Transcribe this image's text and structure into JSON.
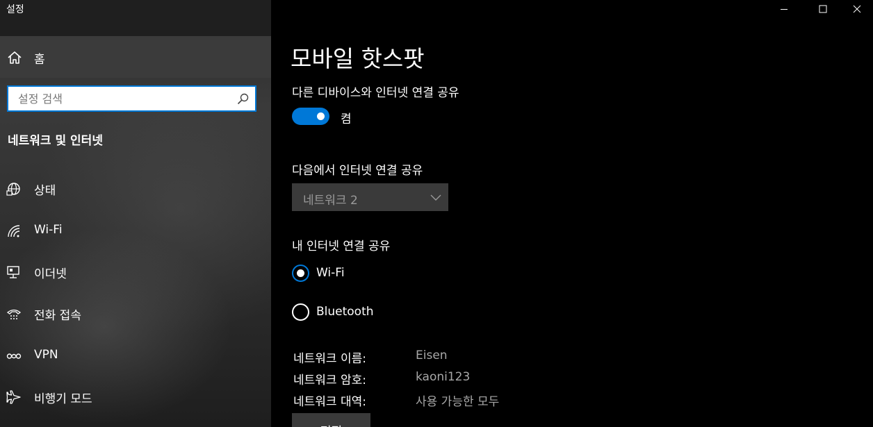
{
  "window": {
    "title": "설정",
    "controls": {
      "minimize": "minimize-icon",
      "maximize": "maximize-icon",
      "close": "close-icon"
    }
  },
  "sidebar": {
    "home_label": "홈",
    "search_placeholder": "설정 검색",
    "section_title": "네트워크 및 인터넷",
    "items": [
      {
        "label": "상태",
        "icon": "globe-icon"
      },
      {
        "label": "Wi-Fi",
        "icon": "wifi-icon"
      },
      {
        "label": "이더넷",
        "icon": "ethernet-icon"
      },
      {
        "label": "전화 접속",
        "icon": "dialup-icon"
      },
      {
        "label": "VPN",
        "icon": "vpn-icon"
      },
      {
        "label": "비행기 모드",
        "icon": "airplane-icon"
      }
    ]
  },
  "main": {
    "title": "모바일 핫스팟",
    "share_label": "다른 디바이스와 인터넷 연결 공유",
    "toggle_state": "켬",
    "toggle_on": true,
    "share_from_label": "다음에서 인터넷 연결 공유",
    "share_from_value": "네트워크 2",
    "share_my_label": "내 인터넷 연결 공유",
    "options": [
      {
        "label": "Wi-Fi",
        "checked": true
      },
      {
        "label": "Bluetooth",
        "checked": false
      }
    ],
    "info": [
      {
        "key": "네트워크 이름:",
        "value": "Eisen"
      },
      {
        "key": "네트워크 암호:",
        "value": "kaoni123"
      },
      {
        "key": "네트워크 대역:",
        "value": "사용 가능한 모두"
      }
    ],
    "edit_label": "편집"
  },
  "colors": {
    "accent": "#0078d7",
    "background": "#000000",
    "sidebar": "#2b2b2b"
  }
}
